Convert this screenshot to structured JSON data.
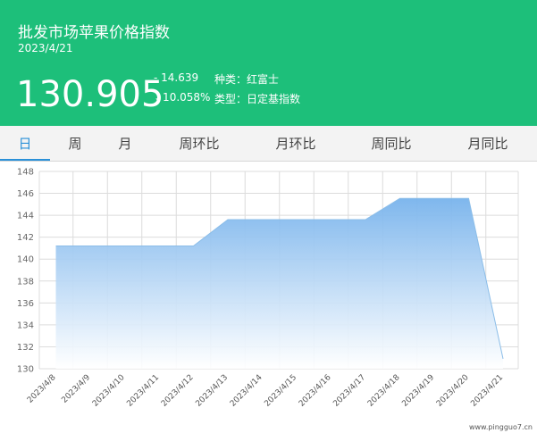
{
  "header": {
    "title": "批发市场苹果价格指数",
    "date": "2023/4/21",
    "price": "130.905",
    "change": "- 14.639",
    "change_pct": "↓10.058%",
    "variety": "种类：红富士",
    "index_type": "类型：日定基指数"
  },
  "tabs": [
    {
      "label": "日",
      "active": true
    },
    {
      "label": "周",
      "active": false
    },
    {
      "label": "月",
      "active": false
    },
    {
      "label": "周环比",
      "active": false
    },
    {
      "label": "月环比",
      "active": false
    },
    {
      "label": "周同比",
      "active": false
    },
    {
      "label": "月同比",
      "active": false
    }
  ],
  "watermark": "www.pingguo7.cn",
  "colors": {
    "header_bg": "#1dbf7a",
    "active_tab": "#2a90d8",
    "area_top": "#78b3ec",
    "area_bottom": "#ffffff",
    "line": "#8bbde8"
  },
  "chart_data": {
    "type": "area",
    "x": [
      "2023/4/8",
      "2023/4/9",
      "2023/4/10",
      "2023/4/11",
      "2023/4/12",
      "2023/4/13",
      "2023/4/14",
      "2023/4/15",
      "2023/4/16",
      "2023/4/17",
      "2023/4/18",
      "2023/4/19",
      "2023/4/20",
      "2023/4/21"
    ],
    "values": [
      141.2,
      141.2,
      141.2,
      141.2,
      141.2,
      143.6,
      143.6,
      143.6,
      143.6,
      143.6,
      145.54,
      145.54,
      145.54,
      130.905
    ],
    "ylim": [
      130,
      148
    ],
    "yticks": [
      130,
      132,
      134,
      136,
      138,
      140,
      142,
      144,
      146,
      148
    ],
    "grid": true,
    "legend": "none"
  }
}
